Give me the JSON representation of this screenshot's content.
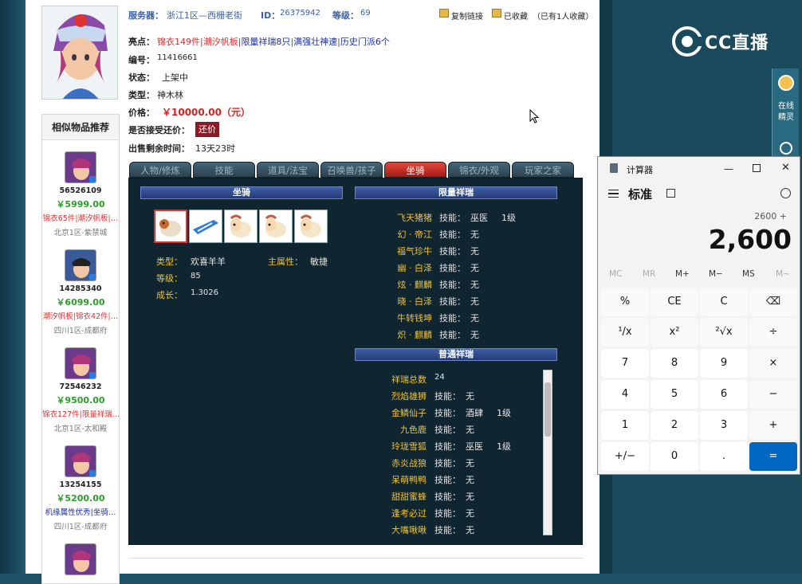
{
  "item": {
    "server_label": "服务器：",
    "server": "浙江1区—西栅老街",
    "id_label": "ID：",
    "id": "26375942",
    "level_label": "等级：",
    "level": "69",
    "copy_link": "复制链接",
    "favorited": "已收藏",
    "fav_count": "（已有1人收藏）",
    "highlights_label": "亮点：",
    "highlights": [
      "锦衣149件",
      "潮汐帆板",
      "限量祥瑞8只",
      "满强壮神速",
      "历史门派6个"
    ],
    "serial_label": "编号：",
    "serial": "11416661",
    "status_label": "状态：",
    "status": "上架中",
    "type_label": "类型：",
    "type": "神木林",
    "price_label": "价格：",
    "price": "￥10000.00（元）",
    "bargain_label": "是否接受还价：",
    "bargain_button": "还价",
    "remaining_label": "出售剩余时间：",
    "remaining": "13天23时"
  },
  "similar": {
    "title": "相似物品推荐",
    "items": [
      {
        "id": "56526109",
        "price": "￥5999.00",
        "tags": "锦衣65件|潮汐帆板|…",
        "server": "北京1区-紫禁城"
      },
      {
        "id": "14285340",
        "price": "￥6099.00",
        "tags": "潮汐帆板|锦衣42件|…",
        "server": "四川1区-成都府"
      },
      {
        "id": "72546232",
        "price": "￥9500.00",
        "tags": "锦衣127件|限量祥瑞…",
        "server": "北京1区-太和殿"
      },
      {
        "id": "13254155",
        "price": "￥5200.00",
        "tags": "机缘属性优秀|坐骑…",
        "server": "四川1区-成都府"
      }
    ]
  },
  "tabs": [
    "人物/修炼",
    "技能",
    "道具/法宝",
    "召唤兽/孩子",
    "坐骑",
    "锦衣/外观",
    "玩家之家"
  ],
  "mount": {
    "header": "坐骑",
    "type_label": "类型：",
    "type": "欢喜羊羊",
    "attr_label": "主属性：",
    "attr": "敏捷",
    "level_label": "等级：",
    "level": "85",
    "growth_label": "成长：",
    "growth": "1.3026"
  },
  "limited": {
    "header": "限量祥瑞",
    "skill_label": "技能：",
    "rows": [
      {
        "name": "飞天猪猪",
        "skill": "巫医",
        "lvl": "1级"
      },
      {
        "name": "幻 · 帝江",
        "skill": "无",
        "lvl": ""
      },
      {
        "name": "福气珍牛",
        "skill": "无",
        "lvl": ""
      },
      {
        "name": "幽 · 白泽",
        "skill": "无",
        "lvl": ""
      },
      {
        "name": "炫 · 麒麟",
        "skill": "无",
        "lvl": ""
      },
      {
        "name": "晓 · 白泽",
        "skill": "无",
        "lvl": ""
      },
      {
        "name": "牛转钱坤",
        "skill": "无",
        "lvl": ""
      },
      {
        "name": "炽 · 麒麟",
        "skill": "无",
        "lvl": ""
      }
    ]
  },
  "normal": {
    "header": "普通祥瑞",
    "total_label": "祥瑞总数",
    "total": "24",
    "skill_label": "技能：",
    "rows": [
      {
        "name": "烈焰雄狮",
        "skill": "无",
        "lvl": ""
      },
      {
        "name": "金鳞仙子",
        "skill": "酒肆",
        "lvl": "1级"
      },
      {
        "name": "九色鹿",
        "skill": "无",
        "lvl": ""
      },
      {
        "name": "玲珑雪狐",
        "skill": "巫医",
        "lvl": "1级"
      },
      {
        "name": "赤炎战狼",
        "skill": "无",
        "lvl": ""
      },
      {
        "name": "呆萌鸭鸭",
        "skill": "无",
        "lvl": ""
      },
      {
        "name": "甜甜蜜蜂",
        "skill": "无",
        "lvl": ""
      },
      {
        "name": "逢考必过",
        "skill": "无",
        "lvl": ""
      },
      {
        "name": "大嘴啾啾",
        "skill": "无",
        "lvl": ""
      }
    ]
  },
  "overlay": {
    "logo": "CC直播",
    "rail_online": "在线",
    "rail_sprite": "精灵"
  },
  "calculator": {
    "title": "计算器",
    "mode": "标准",
    "expression": "2600 +",
    "display": "2,600",
    "memory": [
      "MC",
      "MR",
      "M+",
      "M−",
      "MS",
      "M~"
    ],
    "keys": [
      "%",
      "CE",
      "C",
      "⌫",
      "¹/x",
      "x²",
      "²√x",
      "÷",
      "7",
      "8",
      "9",
      "×",
      "4",
      "5",
      "6",
      "−",
      "1",
      "2",
      "3",
      "+",
      "+/−",
      "0",
      ".",
      "="
    ]
  },
  "colors": {
    "accent_red": "#d6221f",
    "price_green": "#28a028",
    "calc_blue": "#0067c0",
    "panel_dark": "#0f2530"
  }
}
